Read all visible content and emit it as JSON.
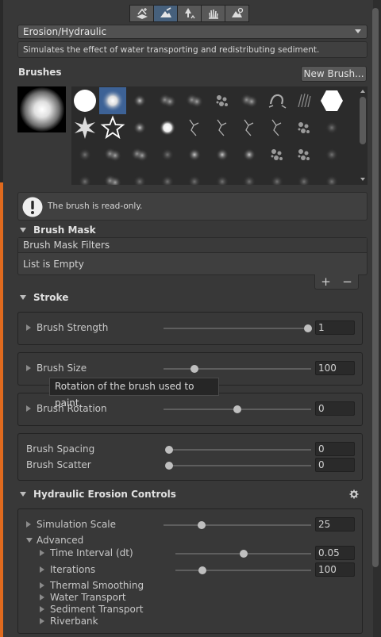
{
  "toolbar": {
    "tools": [
      {
        "icon": "paint-terrain-icon",
        "active": false
      },
      {
        "icon": "erosion-brush-icon",
        "active": true
      },
      {
        "icon": "tree-icon",
        "active": false
      },
      {
        "icon": "details-hand-icon",
        "active": false
      },
      {
        "icon": "terrain-settings-icon",
        "active": false
      }
    ]
  },
  "tool_select": {
    "value": "Erosion/Hydraulic"
  },
  "description": "Simulates the effect of water transporting and redistributing sediment.",
  "brushes": {
    "label": "Brushes",
    "new_brush_label": "New Brush...",
    "selected_index": 1
  },
  "readonly_message": "The brush is read-only.",
  "brush_mask": {
    "title": "Brush Mask",
    "list_header": "Brush Mask Filters",
    "empty_text": "List is Empty",
    "add_label": "+",
    "remove_label": "−"
  },
  "stroke": {
    "title": "Stroke",
    "strength": {
      "label": "Brush Strength",
      "value": "1",
      "fraction": 1.0
    },
    "size": {
      "label": "Brush Size",
      "value": "100",
      "fraction": 0.21
    },
    "rotation": {
      "label": "Brush Rotation",
      "value": "0",
      "fraction": 0.5
    },
    "spacing": {
      "label": "Brush Spacing",
      "value": "0",
      "fraction": 0.0
    },
    "scatter": {
      "label": "Brush Scatter",
      "value": "0",
      "fraction": 0.0
    }
  },
  "tooltip": "Rotation of the brush used to paint.",
  "hydraulic": {
    "title": "Hydraulic Erosion Controls",
    "sim_scale": {
      "label": "Simulation Scale",
      "value": "25",
      "fraction": 0.26
    },
    "advanced_label": "Advanced",
    "time_interval": {
      "label": "Time Interval (dt)",
      "value": "0.05",
      "fraction": 0.5
    },
    "iterations": {
      "label": "Iterations",
      "value": "100",
      "fraction": 0.2
    },
    "groups": [
      "Thermal Smoothing",
      "Water Transport",
      "Sediment Transport",
      "Riverbank"
    ]
  }
}
